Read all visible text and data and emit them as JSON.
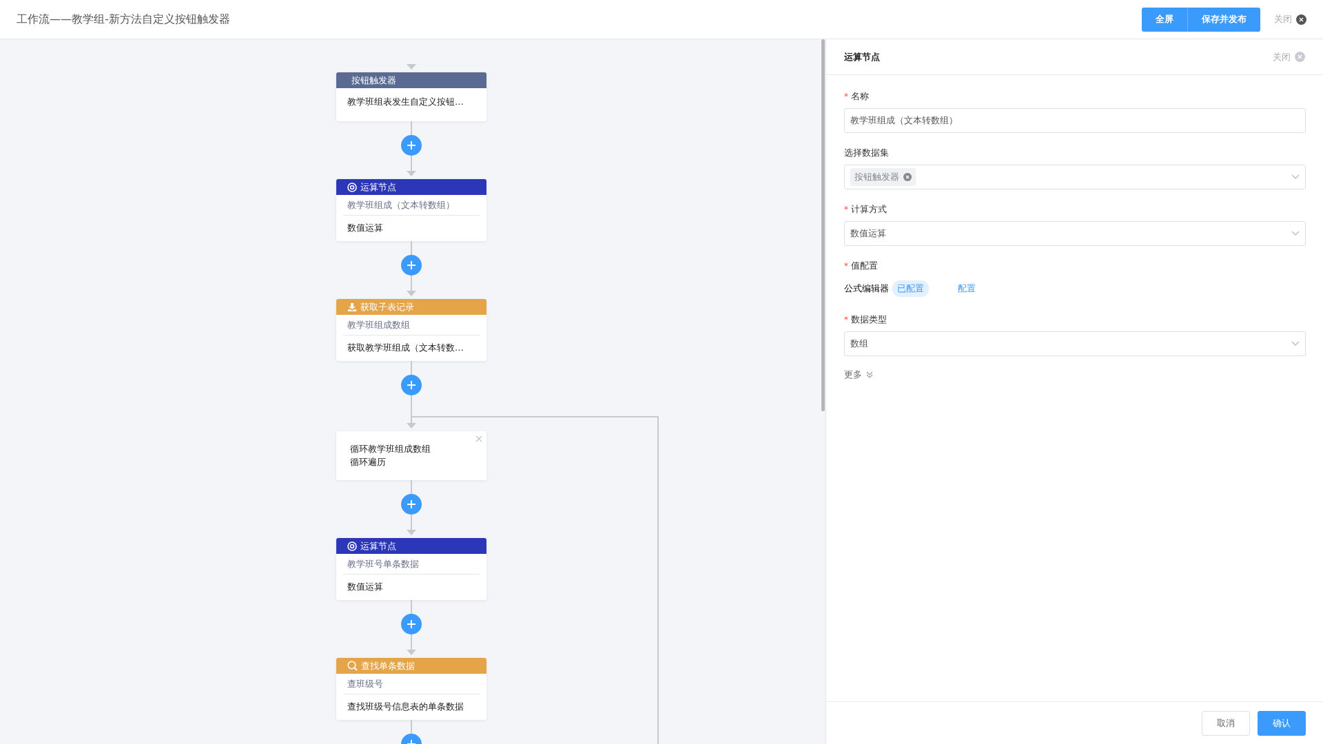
{
  "header": {
    "title": "工作流——教学组-新方法自定义按钮触发器",
    "buttons": [
      {
        "label": "全屏"
      },
      {
        "label": "保存并发布"
      }
    ],
    "close": "关闭"
  },
  "flow": {
    "nodes": [
      {
        "kind": "trigger",
        "title": "按钮触发器",
        "color": "#5a6a92",
        "text": "教学班组表发生自定义按钮…"
      },
      {
        "kind": "calc",
        "title": "运算节点",
        "color": "#2b36b8",
        "subtitle": "教学班组成（文本转数组）",
        "text": "数值运算"
      },
      {
        "kind": "fetch",
        "title": "获取子表记录",
        "color": "#e5a448",
        "subtitle": "教学班组成数组",
        "text": "获取教学班组成（文本转数…"
      },
      {
        "kind": "loop",
        "lines": [
          "循环教学班组成数组",
          "循环遍历"
        ]
      },
      {
        "kind": "calc",
        "title": "运算节点",
        "color": "#2b36b8",
        "subtitle": "教学班号单条数据",
        "text": "数值运算"
      },
      {
        "kind": "search",
        "title": "查找单条数据",
        "color": "#e5a448",
        "subtitle": "查班级号",
        "text": "查找班级号信息表的单条数据"
      }
    ]
  },
  "panel": {
    "title": "运算节点",
    "close": "关闭",
    "fields": [
      {
        "kind": "input",
        "label": "名称",
        "required_mark": "*",
        "value": "教学班组成（文本转数组）"
      },
      {
        "kind": "tagselect",
        "label": "选择数据集",
        "tags": [
          "按钮触发器"
        ]
      },
      {
        "kind": "select",
        "label": "计算方式",
        "required_mark": "*",
        "value": "数值运算"
      },
      {
        "kind": "formula",
        "label": "值配置",
        "required_mark": "*",
        "editor": "公式编辑器",
        "status": "已配置",
        "link": "配置"
      },
      {
        "kind": "select",
        "label": "数据类型",
        "required_mark": "*",
        "value": "数组"
      }
    ],
    "more": "更多",
    "buttons": [
      {
        "kind": "secondary",
        "label": "取消"
      },
      {
        "kind": "primary",
        "label": "确认"
      }
    ]
  }
}
